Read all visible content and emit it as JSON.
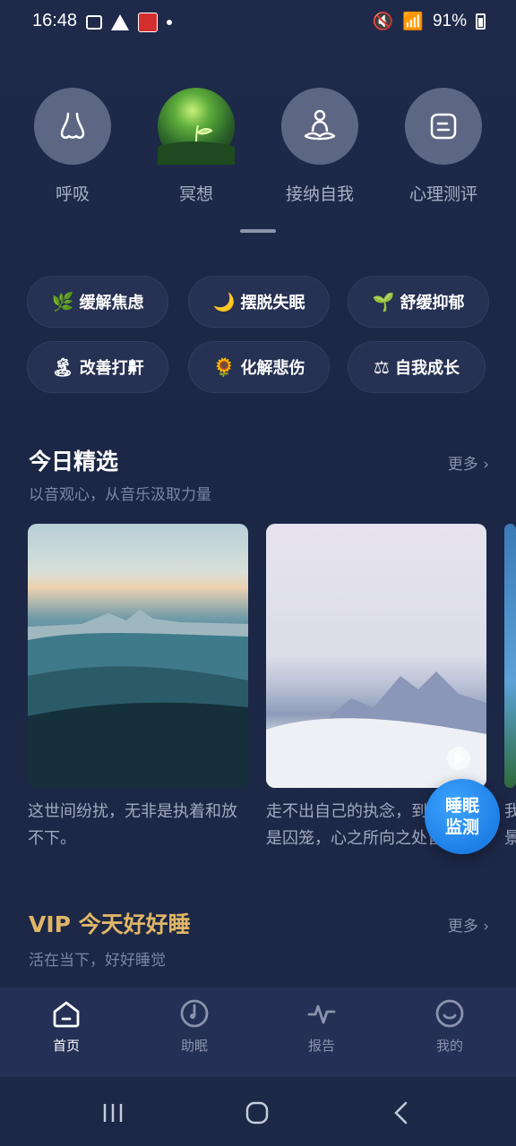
{
  "status": {
    "time": "16:48",
    "battery": "91%"
  },
  "top_nav": [
    {
      "label": "呼吸",
      "icon": "nose-icon"
    },
    {
      "label": "冥想",
      "icon": "meditation-photo"
    },
    {
      "label": "接纳自我",
      "icon": "lotus-pose-icon"
    },
    {
      "label": "心理测评",
      "icon": "assessment-icon"
    }
  ],
  "chips": [
    {
      "emoji": "🌿",
      "label": "缓解焦虑"
    },
    {
      "emoji": "🌙",
      "label": "摆脱失眠"
    },
    {
      "emoji": "🌱",
      "label": "舒缓抑郁"
    },
    {
      "emoji": "🏝",
      "label": "改善打鼾"
    },
    {
      "emoji": "🌻",
      "label": "化解悲伤"
    },
    {
      "emoji": "⚖",
      "label": "自我成长"
    }
  ],
  "today": {
    "title": "今日精选",
    "subtitle": "以音观心，从音乐汲取力量",
    "more": "更多",
    "cards": [
      {
        "caption": "这世间纷扰，无非是执着和放不下。"
      },
      {
        "caption": "走不出自己的执念，到哪里都是囚笼，心之所向之处皆为牢笼。"
      },
      {
        "caption": "我景"
      }
    ]
  },
  "float_button": {
    "line1": "睡眠",
    "line2": "监测"
  },
  "vip": {
    "title": "VIP 今天好好睡",
    "subtitle": "活在当下，好好睡觉",
    "more": "更多"
  },
  "bottom_nav": [
    {
      "label": "首页",
      "active": true
    },
    {
      "label": "助眠",
      "active": false
    },
    {
      "label": "报告",
      "active": false
    },
    {
      "label": "我的",
      "active": false
    }
  ],
  "colors": {
    "accent": "#1d7fe6",
    "vip": "#e0b667",
    "background": "#1f2a4a"
  }
}
